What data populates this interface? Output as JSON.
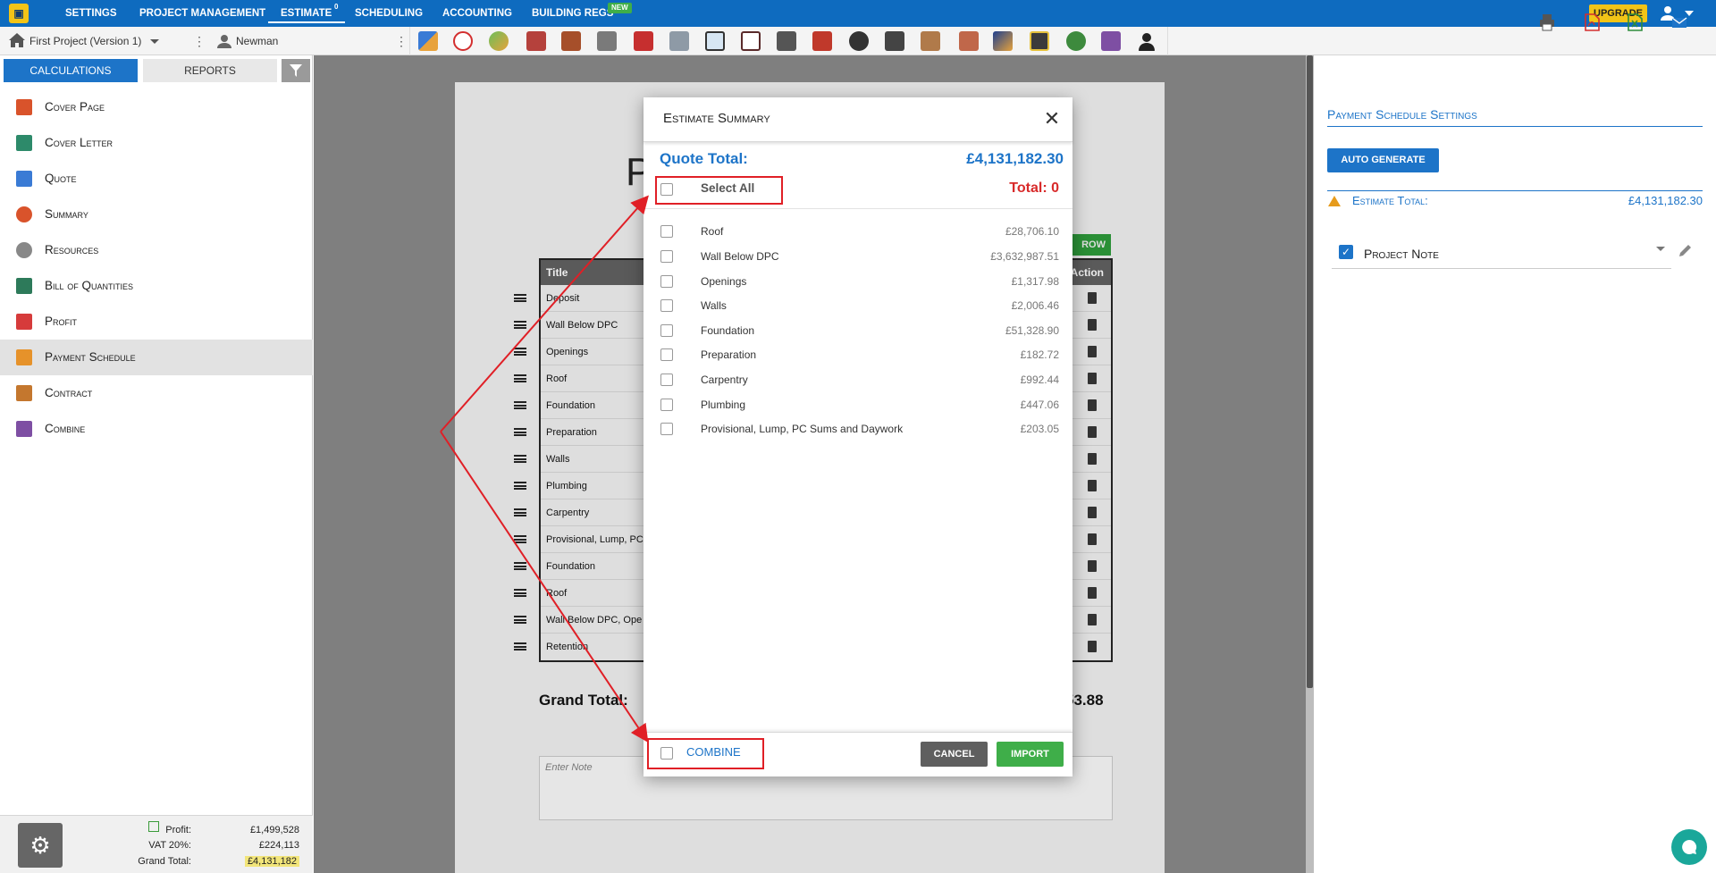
{
  "topnav": {
    "items": [
      "SETTINGS",
      "PROJECT MANAGEMENT",
      "ESTIMATE",
      "SCHEDULING",
      "ACCOUNTING",
      "BUILDING REGS"
    ],
    "estimate_badge": "0",
    "new_badge": "NEW",
    "upgrade": "UPGRADE"
  },
  "toolbar": {
    "project": "First Project (Version 1)",
    "user": "Newman"
  },
  "left_tabs": {
    "calculations": "CALCULATIONS",
    "reports": "REPORTS"
  },
  "sidebar": {
    "items": [
      {
        "label": "Cover Page",
        "icon": "cover-page-icon"
      },
      {
        "label": "Cover Letter",
        "icon": "cover-letter-icon"
      },
      {
        "label": "Quote",
        "icon": "quote-icon"
      },
      {
        "label": "Summary",
        "icon": "summary-icon"
      },
      {
        "label": "Resources",
        "icon": "resources-icon"
      },
      {
        "label": "Bill of Quantities",
        "icon": "bill-of-quantities-icon"
      },
      {
        "label": "Profit",
        "icon": "profit-icon"
      },
      {
        "label": "Payment Schedule",
        "icon": "payment-schedule-icon"
      },
      {
        "label": "Contract",
        "icon": "contract-icon"
      },
      {
        "label": "Combine",
        "icon": "combine-icon"
      }
    ],
    "active_index": 7
  },
  "summary": {
    "profit_label": "Profit:",
    "profit_value": "£1,499,528",
    "vat_label": "VAT 20%:",
    "vat_value": "£224,113",
    "grand_label": "Grand Total:",
    "grand_value": "£4,131,182"
  },
  "document": {
    "heading_letter": "P",
    "add_row_label": "ROW",
    "table_header_title": "Title",
    "table_header_action": "Action",
    "rows": [
      "Deposit",
      "Wall Below DPC",
      "Openings",
      "Roof",
      "Foundation",
      "Preparation",
      "Walls",
      "Plumbing",
      "Carpentry",
      "Provisional, Lump, PC",
      "Foundation",
      "Roof",
      "Wall Below DPC, Ope",
      "Retention"
    ],
    "grand_total_label": "Grand Total:",
    "grand_total_value": "53.88",
    "note_placeholder": "Enter Note"
  },
  "right_panel": {
    "title": "Payment Schedule Settings",
    "auto_generate": "AUTO GENERATE",
    "estimate_total_label": "Estimate Total:",
    "estimate_total_value": "£4,131,182.30",
    "project_note": "Project Note"
  },
  "modal": {
    "title": "Estimate Summary",
    "quote_total_label": "Quote Total:",
    "quote_total_value": "£4,131,182.30",
    "select_all": "Select All",
    "total_label": "Total: 0",
    "items": [
      {
        "name": "Roof",
        "value": "£28,706.10"
      },
      {
        "name": "Wall Below DPC",
        "value": "£3,632,987.51"
      },
      {
        "name": "Openings",
        "value": "£1,317.98"
      },
      {
        "name": "Walls",
        "value": "£2,006.46"
      },
      {
        "name": "Foundation",
        "value": "£51,328.90"
      },
      {
        "name": "Preparation",
        "value": "£182.72"
      },
      {
        "name": "Carpentry",
        "value": "£992.44"
      },
      {
        "name": "Plumbing",
        "value": "£447.06"
      },
      {
        "name": "Provisional, Lump, PC Sums and Daywork",
        "value": "£203.05"
      }
    ],
    "combine": "COMBINE",
    "cancel": "CANCEL",
    "import": "IMPORT"
  },
  "colors": {
    "primary": "#1d74c8",
    "annotation": "#e01f26",
    "import_green": "#3fae49"
  }
}
